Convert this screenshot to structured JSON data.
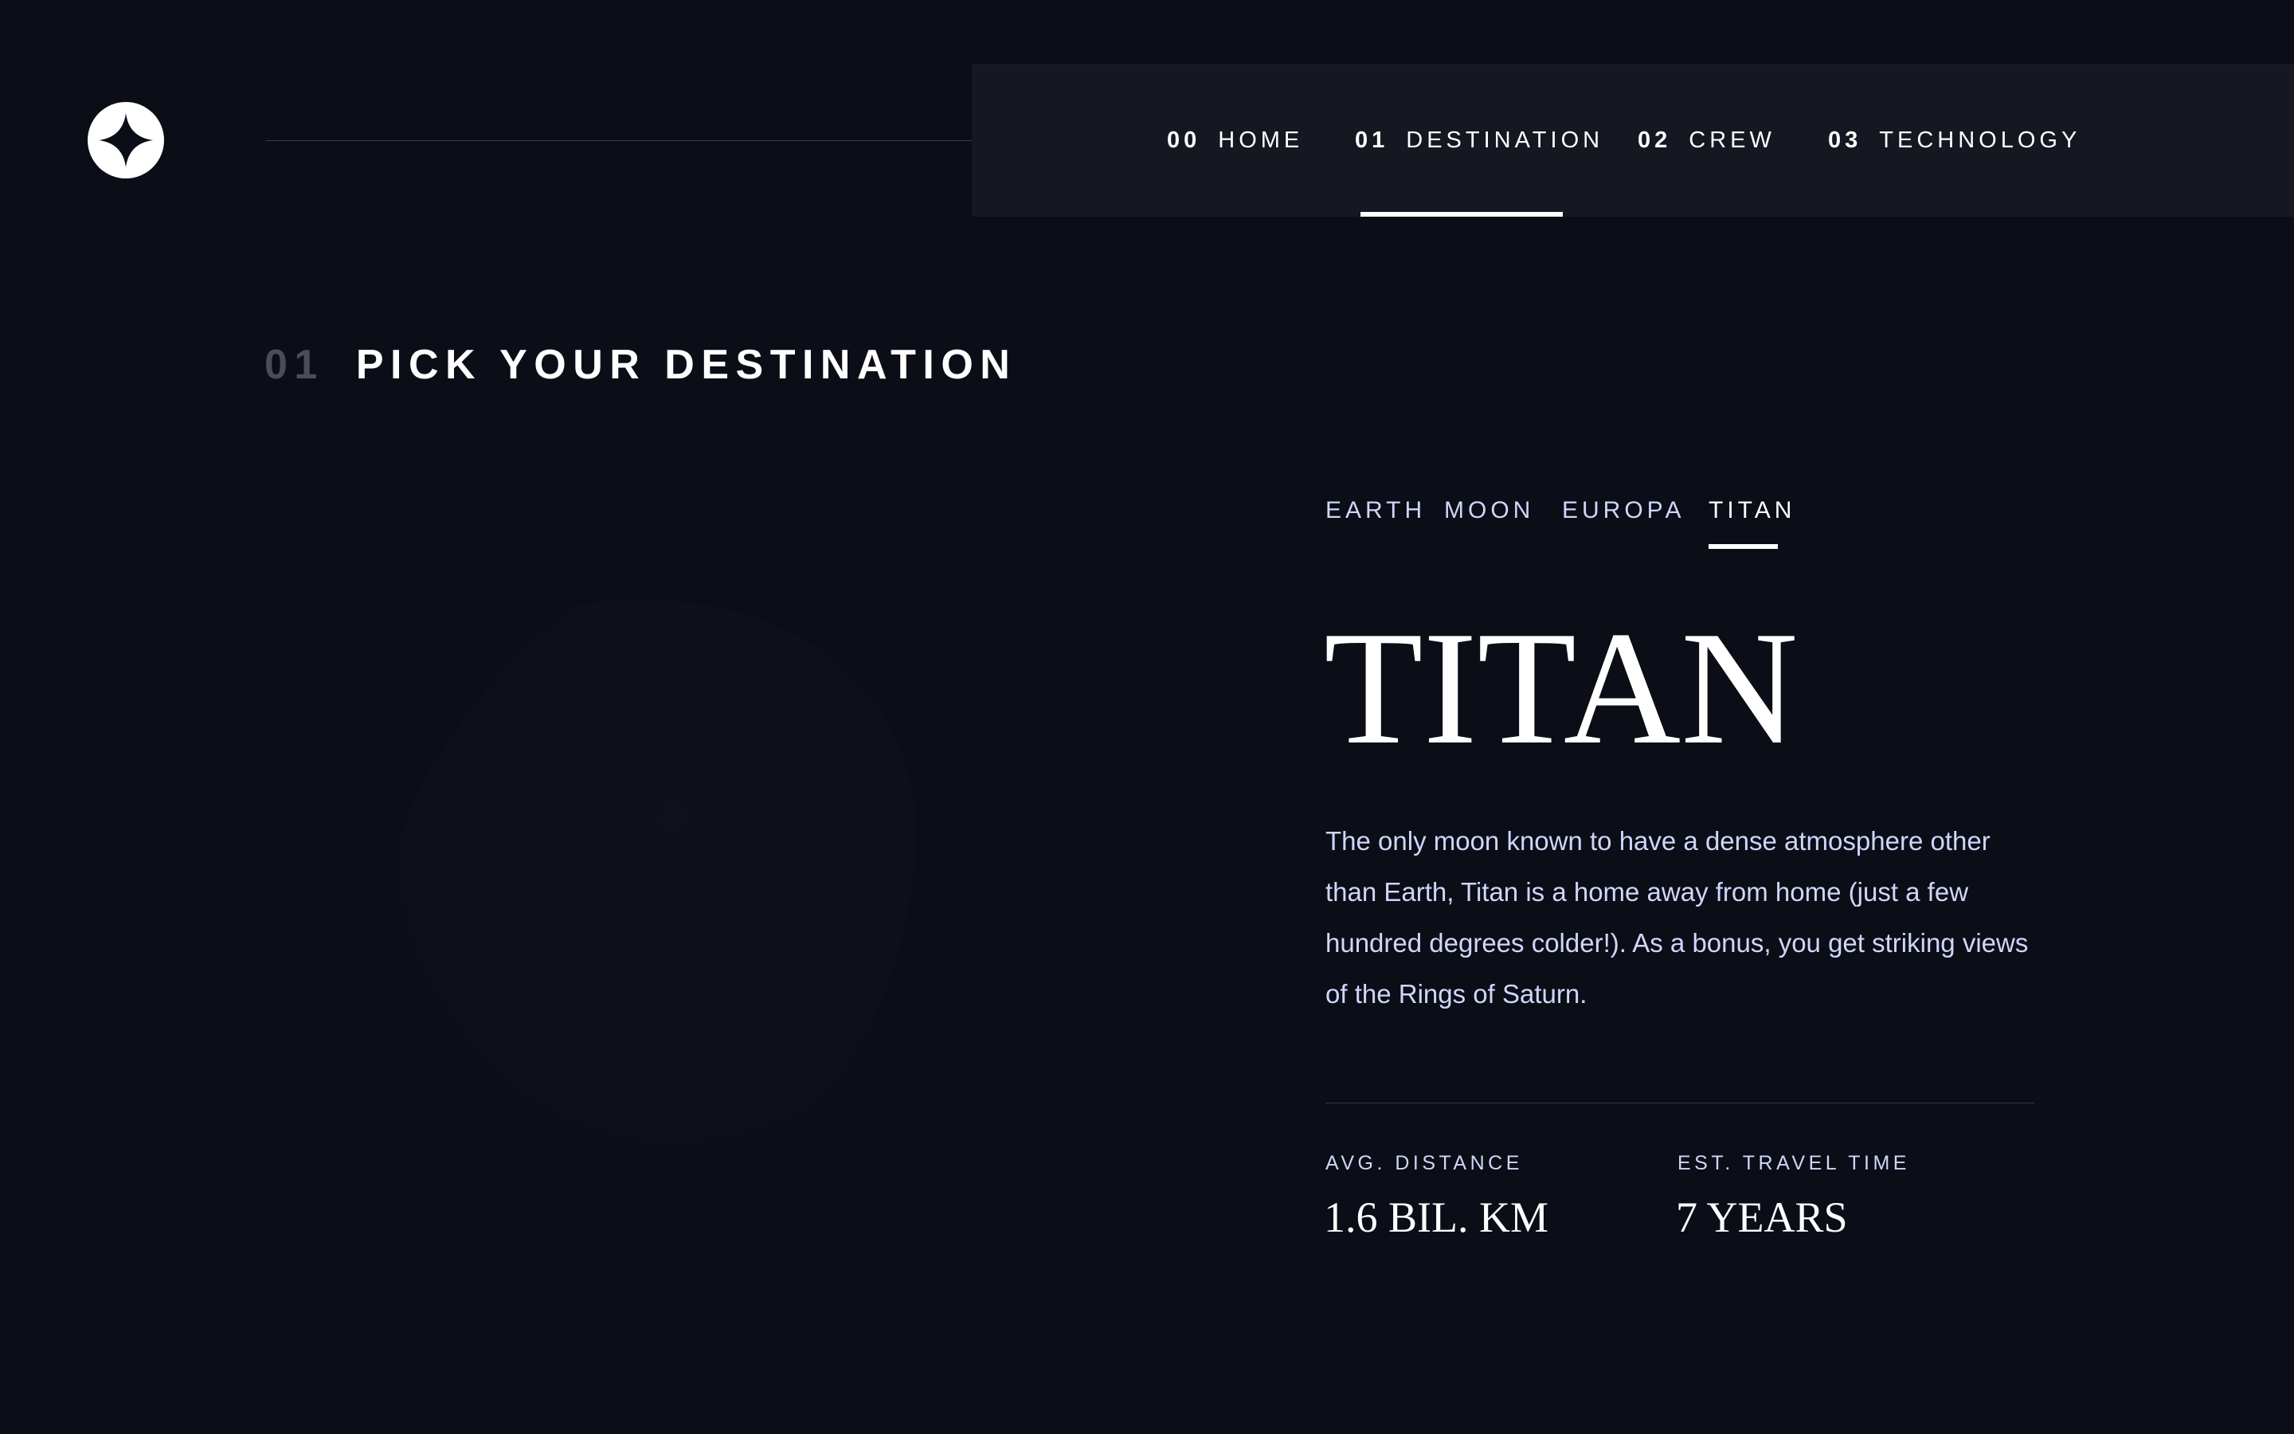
{
  "header": {
    "nav": [
      {
        "num": "00",
        "label": "HOME"
      },
      {
        "num": "01",
        "label": "DESTINATION"
      },
      {
        "num": "02",
        "label": "CREW"
      },
      {
        "num": "03",
        "label": "TECHNOLOGY"
      }
    ],
    "active_nav": "DESTINATION"
  },
  "section": {
    "num": "01",
    "title": "PICK YOUR DESTINATION"
  },
  "tabs": [
    "EARTH",
    "MOON",
    "EUROPA",
    "TITAN"
  ],
  "active_tab": "TITAN",
  "destination": {
    "name": "TITAN",
    "description": "The only moon known to have a dense atmosphere other than Earth, Titan is a home away from home (just a few hundred degrees colder!). As a bonus, you get striking views of the Rings of Saturn.",
    "distance_label": "AVG. DISTANCE",
    "distance_value": "1.6 BIL. KM",
    "travel_label": "EST. TRAVEL TIME",
    "travel_value": "7 YEARS"
  },
  "icons": {
    "logo": "star-logo-icon",
    "planet": "titan-planet-image"
  },
  "colors": {
    "background": "#0b0d17",
    "nav_panel": "#151820",
    "text_primary": "#ffffff",
    "text_secondary": "#d0d6f9",
    "section_number": "#4a4c57"
  }
}
